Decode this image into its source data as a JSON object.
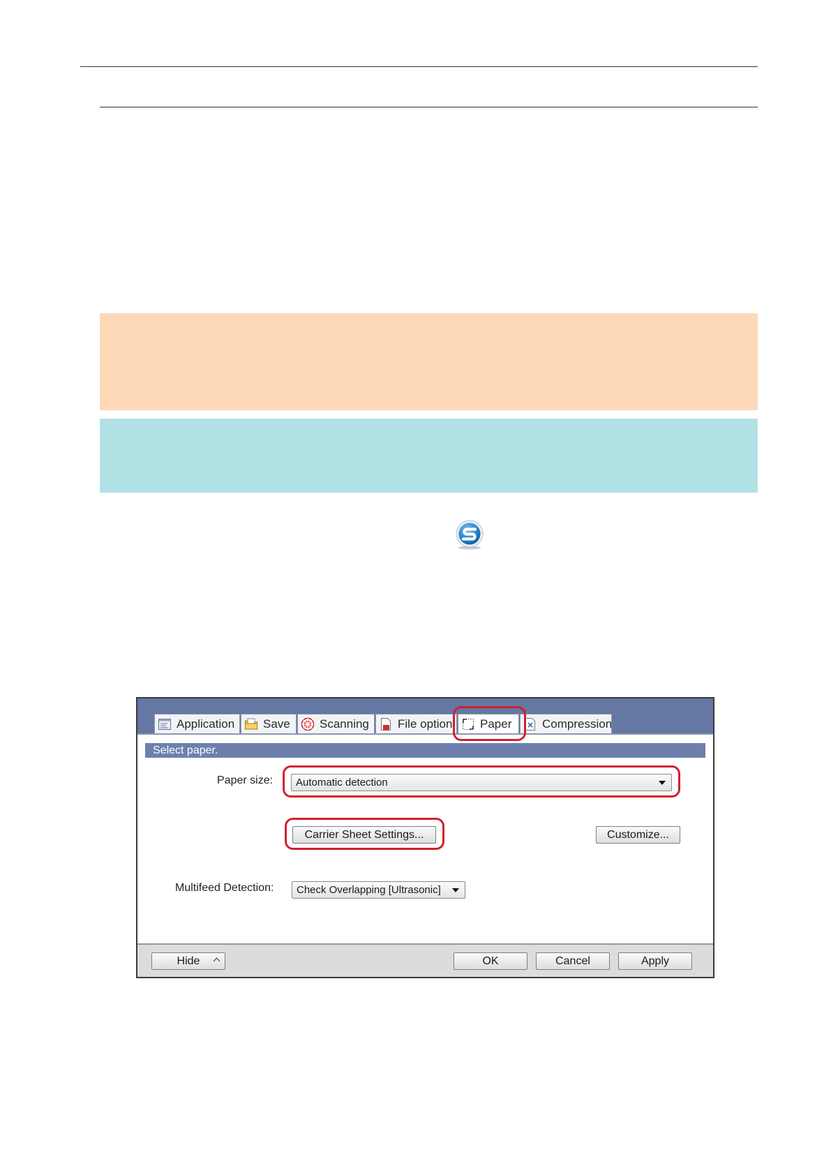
{
  "dialog": {
    "tabs": [
      {
        "label": "Application",
        "icon": "application-icon"
      },
      {
        "label": "Save",
        "icon": "folder-icon"
      },
      {
        "label": "Scanning",
        "icon": "scanning-icon"
      },
      {
        "label": "File option",
        "icon": "file-option-icon"
      },
      {
        "label": "Paper",
        "icon": "paper-icon",
        "active": true
      },
      {
        "label": "Compression",
        "icon": "compression-icon"
      }
    ],
    "section_title": "Select paper.",
    "paper_size_label": "Paper size:",
    "paper_size_value": "Automatic detection",
    "carrier_sheet_button": "Carrier Sheet Settings...",
    "customize_button": "Customize...",
    "multifeed_label": "Multifeed Detection:",
    "multifeed_value": "Check Overlapping [Ultrasonic]",
    "footer": {
      "hide_button": "Hide",
      "ok_button": "OK",
      "cancel_button": "Cancel",
      "apply_button": "Apply"
    }
  },
  "colors": {
    "attention_box": "#fdd9b9",
    "hint_box": "#b1e1e5",
    "dialog_header": "#6577a3",
    "highlight": "#d2202f"
  }
}
